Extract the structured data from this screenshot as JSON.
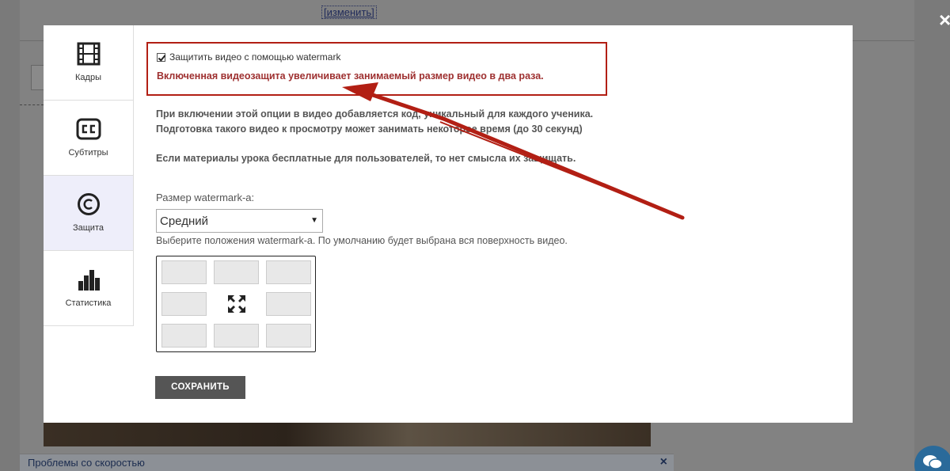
{
  "background": {
    "change_link": "[изменить]",
    "footer_text": "Проблемы со скоростью",
    "footer_close": "×",
    "overlay_close": "×"
  },
  "sidebar": {
    "items": [
      {
        "label": "Кадры",
        "icon": "film-icon"
      },
      {
        "label": "Субтитры",
        "icon": "subtitles-icon"
      },
      {
        "label": "Защита",
        "icon": "copyright-icon",
        "active": true
      },
      {
        "label": "Статистика",
        "icon": "bar-chart-icon"
      }
    ]
  },
  "protection": {
    "checkbox_label": "Защитить видео с помощью watermark",
    "checked": true,
    "warning": "Включенная видеозащита увеличивает занимаемый размер видео в два раза.",
    "info_line1": "При включении этой опции в видео добавляется код, уникальный для каждого ученика.",
    "info_line2": "Подготовка такого видео к просмотру может занимать некоторое время (до 30 секунд)",
    "info_line3": "Если материалы урока бесплатные для пользователей, то нет смысла их защищать.",
    "size_label": "Размер watermark-а:",
    "size_value": "Средний",
    "position_label": "Выберите положения watermark-а. По умолчанию будет выбрана вся поверхность видео.",
    "save_label": "СОХРАНИТЬ"
  },
  "colors": {
    "warning_border": "#b21f14",
    "warning_text": "#9e3030",
    "annotation_arrow": "#b21f14",
    "active_tab_bg": "#eeeefa"
  }
}
